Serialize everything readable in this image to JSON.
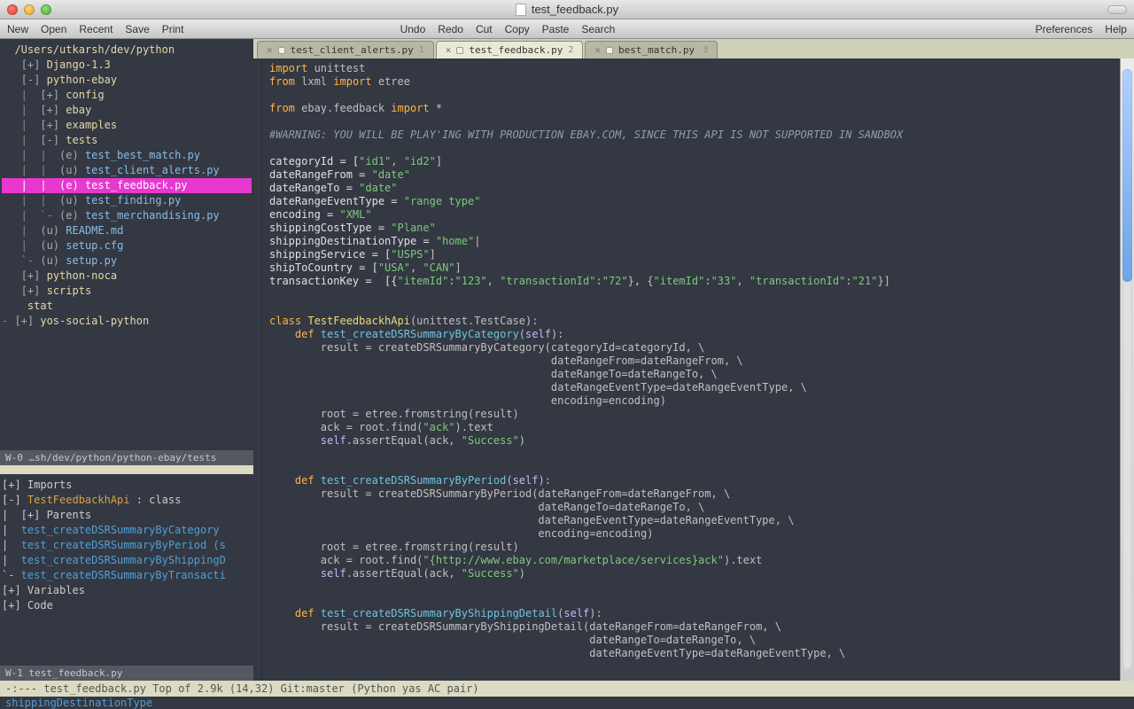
{
  "window": {
    "title": "test_feedback.py"
  },
  "menu": {
    "left": [
      "New",
      "Open",
      "Recent",
      "Save",
      "Print"
    ],
    "center": [
      "Undo",
      "Redo",
      "Cut",
      "Copy",
      "Paste",
      "Search"
    ],
    "right": [
      "Preferences",
      "Help"
    ]
  },
  "tabs": [
    {
      "label": "test_client_alerts.py",
      "index": "1",
      "active": false
    },
    {
      "label": "test_feedback.py",
      "index": "2",
      "active": true
    },
    {
      "label": "best_match.py",
      "index": "3",
      "active": false
    }
  ],
  "tree": {
    "root": "/Users/utkarsh/dev/python",
    "rows": [
      {
        "indent": 0,
        "toggle": "[+]",
        "kind": "dir",
        "label": "Django-1.3"
      },
      {
        "indent": 0,
        "toggle": "[-]",
        "kind": "dir",
        "label": "python-ebay"
      },
      {
        "indent": 1,
        "toggle": "[+]",
        "kind": "dir",
        "label": "config"
      },
      {
        "indent": 1,
        "toggle": "[+]",
        "kind": "dir",
        "label": "ebay"
      },
      {
        "indent": 1,
        "toggle": "[+]",
        "kind": "dir",
        "label": "examples"
      },
      {
        "indent": 1,
        "toggle": "[-]",
        "kind": "dir",
        "label": "tests"
      },
      {
        "indent": 2,
        "toggle": "(e)",
        "kind": "file",
        "label": "test_best_match.py"
      },
      {
        "indent": 2,
        "toggle": "(u)",
        "kind": "file",
        "label": "test_client_alerts.py"
      },
      {
        "indent": 2,
        "toggle": "(e)",
        "kind": "file",
        "label": "test_feedback.py",
        "selected": true
      },
      {
        "indent": 2,
        "toggle": "(u)",
        "kind": "file",
        "label": "test_finding.py"
      },
      {
        "indent": 2,
        "toggle": "(e)",
        "kind": "file",
        "label": "test_merchandising.py",
        "last": true
      },
      {
        "indent": 1,
        "toggle": "(u)",
        "kind": "file",
        "label": "README.md"
      },
      {
        "indent": 1,
        "toggle": "(u)",
        "kind": "file",
        "label": "setup.cfg"
      },
      {
        "indent": 1,
        "toggle": "(u)",
        "kind": "file",
        "label": "setup.py",
        "last": true
      },
      {
        "indent": 0,
        "toggle": "[+]",
        "kind": "dir",
        "label": "python-noca"
      },
      {
        "indent": 0,
        "toggle": "[+]",
        "kind": "dir",
        "label": "scripts"
      },
      {
        "indent": 0,
        "toggle": "",
        "kind": "dir",
        "label": "stat"
      },
      {
        "indent": -1,
        "toggle": "[+]",
        "kind": "dir",
        "label": "yos-social-python"
      }
    ]
  },
  "tree_modeline": "W-0 …sh/dev/python/python-ebay/tests",
  "outline": {
    "rows": [
      {
        "text": "[+] Imports",
        "kind": "plain"
      },
      {
        "text": "[-] TestFeedbackhApi : class",
        "kind": "class"
      },
      {
        "text": "|  [+] Parents",
        "kind": "plain"
      },
      {
        "text": "|  test_createDSRSummaryByCategory",
        "kind": "fn"
      },
      {
        "text": "|  test_createDSRSummaryByPeriod (s",
        "kind": "fn"
      },
      {
        "text": "|  test_createDSRSummaryByShippingD",
        "kind": "fn"
      },
      {
        "text": "`- test_createDSRSummaryByTransacti",
        "kind": "fn"
      },
      {
        "text": "[+] Variables",
        "kind": "plain"
      },
      {
        "text": "[+] Code",
        "kind": "plain"
      }
    ],
    "modeline": "W-1 test_feedback.py"
  },
  "code": {
    "lines": [
      [
        [
          "kw",
          "import"
        ],
        [
          "op",
          " unittest"
        ]
      ],
      [
        [
          "kw",
          "from"
        ],
        [
          "op",
          " lxml "
        ],
        [
          "kw",
          "import"
        ],
        [
          "op",
          " etree"
        ]
      ],
      [],
      [
        [
          "kw",
          "from"
        ],
        [
          "op",
          " ebay.feedback "
        ],
        [
          "kw",
          "import"
        ],
        [
          "op",
          " *"
        ]
      ],
      [],
      [
        [
          "cmt",
          "#WARNING: YOU WILL BE PLAY'ING WITH PRODUCTION EBAY.COM, SINCE THIS API IS NOT SUPPORTED IN SANDBOX"
        ]
      ],
      [],
      [
        [
          "var",
          "categoryId = ["
        ],
        [
          "str",
          "\"id1\""
        ],
        [
          "op",
          ", "
        ],
        [
          "str",
          "\"id2\""
        ],
        [
          "op",
          "]"
        ]
      ],
      [
        [
          "var",
          "dateRangeFrom = "
        ],
        [
          "str",
          "\"date\""
        ]
      ],
      [
        [
          "var",
          "dateRangeTo = "
        ],
        [
          "str",
          "\"date\""
        ]
      ],
      [
        [
          "var",
          "dateRangeEventType = "
        ],
        [
          "str",
          "\"range type\""
        ]
      ],
      [
        [
          "var",
          "encoding = "
        ],
        [
          "str",
          "\"XML\""
        ]
      ],
      [
        [
          "var",
          "shippingCostType = "
        ],
        [
          "str",
          "\"Plane\""
        ]
      ],
      [
        [
          "var",
          "shippingDestinationType = "
        ],
        [
          "str",
          "\"home\""
        ],
        [
          "op",
          "|"
        ]
      ],
      [
        [
          "var",
          "shippingService = ["
        ],
        [
          "str",
          "\"USPS\""
        ],
        [
          "op",
          "]"
        ]
      ],
      [
        [
          "var",
          "shipToCountry = ["
        ],
        [
          "str",
          "\"USA\""
        ],
        [
          "op",
          ", "
        ],
        [
          "str",
          "\"CAN\""
        ],
        [
          "op",
          "]"
        ]
      ],
      [
        [
          "var",
          "transactionKey =  [{"
        ],
        [
          "str",
          "\"itemId\""
        ],
        [
          "op",
          ":"
        ],
        [
          "str",
          "\"123\""
        ],
        [
          "op",
          ", "
        ],
        [
          "str",
          "\"transactionId\""
        ],
        [
          "op",
          ":"
        ],
        [
          "str",
          "\"72\""
        ],
        [
          "op",
          "}, {"
        ],
        [
          "str",
          "\"itemId\""
        ],
        [
          "op",
          ":"
        ],
        [
          "str",
          "\"33\""
        ],
        [
          "op",
          ", "
        ],
        [
          "str",
          "\"transactionId\""
        ],
        [
          "op",
          ":"
        ],
        [
          "str",
          "\"21\""
        ],
        [
          "op",
          "}]"
        ]
      ],
      [],
      [],
      [
        [
          "kw",
          "class"
        ],
        [
          "op",
          " "
        ],
        [
          "cls",
          "TestFeedbackhApi"
        ],
        [
          "op",
          "(unittest.TestCase):"
        ]
      ],
      [
        [
          "op",
          "    "
        ],
        [
          "kw",
          "def"
        ],
        [
          "op",
          " "
        ],
        [
          "fn",
          "test_createDSRSummaryByCategory"
        ],
        [
          "op",
          "("
        ],
        [
          "self",
          "self"
        ],
        [
          "op",
          "):"
        ]
      ],
      [
        [
          "op",
          "        result = createDSRSummaryByCategory(categoryId=categoryId, \\"
        ]
      ],
      [
        [
          "op",
          "                                            dateRangeFrom=dateRangeFrom, \\"
        ]
      ],
      [
        [
          "op",
          "                                            dateRangeTo=dateRangeTo, \\"
        ]
      ],
      [
        [
          "op",
          "                                            dateRangeEventType=dateRangeEventType, \\"
        ]
      ],
      [
        [
          "op",
          "                                            encoding=encoding)"
        ]
      ],
      [
        [
          "op",
          "        root = etree.fromstring(result)"
        ]
      ],
      [
        [
          "op",
          "        ack = root.find("
        ],
        [
          "str",
          "\"ack\""
        ],
        [
          "op",
          ").text"
        ]
      ],
      [
        [
          "op",
          "        "
        ],
        [
          "self",
          "self"
        ],
        [
          "op",
          ".assertEqual(ack, "
        ],
        [
          "str",
          "\"Success\""
        ],
        [
          "op",
          ")"
        ]
      ],
      [],
      [],
      [
        [
          "op",
          "    "
        ],
        [
          "kw",
          "def"
        ],
        [
          "op",
          " "
        ],
        [
          "fn",
          "test_createDSRSummaryByPeriod"
        ],
        [
          "op",
          "("
        ],
        [
          "self",
          "self"
        ],
        [
          "op",
          "):"
        ]
      ],
      [
        [
          "op",
          "        result = createDSRSummaryByPeriod(dateRangeFrom=dateRangeFrom, \\"
        ]
      ],
      [
        [
          "op",
          "                                          dateRangeTo=dateRangeTo, \\"
        ]
      ],
      [
        [
          "op",
          "                                          dateRangeEventType=dateRangeEventType, \\"
        ]
      ],
      [
        [
          "op",
          "                                          encoding=encoding)"
        ]
      ],
      [
        [
          "op",
          "        root = etree.fromstring(result)"
        ]
      ],
      [
        [
          "op",
          "        ack = root.find("
        ],
        [
          "str",
          "\"{http://www.ebay.com/marketplace/services}ack\""
        ],
        [
          "op",
          ").text"
        ]
      ],
      [
        [
          "op",
          "        "
        ],
        [
          "self",
          "self"
        ],
        [
          "op",
          ".assertEqual(ack, "
        ],
        [
          "str",
          "\"Success\""
        ],
        [
          "op",
          ")"
        ]
      ],
      [],
      [],
      [
        [
          "op",
          "    "
        ],
        [
          "kw",
          "def"
        ],
        [
          "op",
          " "
        ],
        [
          "fn",
          "test_createDSRSummaryByShippingDetail"
        ],
        [
          "op",
          "("
        ],
        [
          "self",
          "self"
        ],
        [
          "op",
          "):"
        ]
      ],
      [
        [
          "op",
          "        result = createDSRSummaryByShippingDetail(dateRangeFrom=dateRangeFrom, \\"
        ]
      ],
      [
        [
          "op",
          "                                                  dateRangeTo=dateRangeTo, \\"
        ]
      ],
      [
        [
          "op",
          "                                                  dateRangeEventType=dateRangeEventType, \\"
        ]
      ]
    ]
  },
  "modeline": "-:---  test_feedback.py   Top of 2.9k (14,32)   Git:master  (Python yas AC pair)",
  "minibuffer": "shippingDestinationType"
}
